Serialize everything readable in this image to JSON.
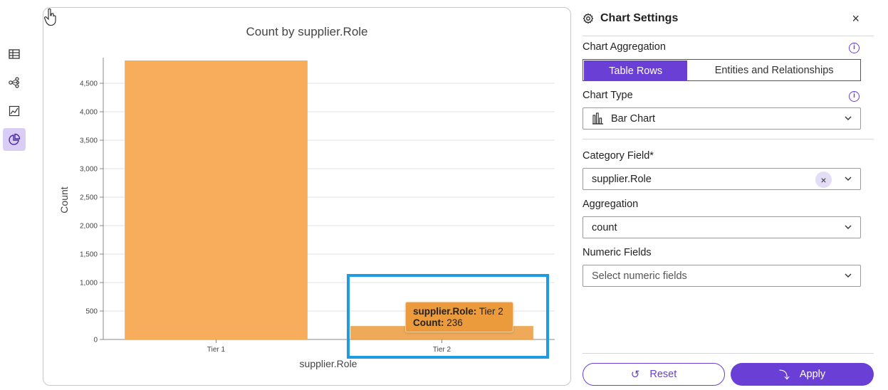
{
  "rail": {
    "items": [
      {
        "icon": "table-icon",
        "active": false
      },
      {
        "icon": "graph-network-icon",
        "active": false
      },
      {
        "icon": "chart-line-icon",
        "active": false
      },
      {
        "icon": "pie-chart-icon",
        "active": true
      }
    ]
  },
  "chart_data": {
    "type": "bar",
    "title": "Count by supplier.Role",
    "xlabel": "supplier.Role",
    "ylabel": "Count",
    "categories": [
      "Tier 1",
      "Tier 2"
    ],
    "values": [
      4900,
      236
    ],
    "yticks": [
      0,
      500,
      1000,
      1500,
      2000,
      2500,
      3000,
      3500,
      4000,
      4500
    ],
    "ytick_labels": [
      "0",
      "500",
      "1,000",
      "1,500",
      "2,000",
      "2,500",
      "3,000",
      "3,500",
      "4,000",
      "4,500"
    ],
    "ylim": [
      0,
      4950
    ],
    "bar_color": "#f7ad5b",
    "hover_bar_color": "#eb9a3c",
    "grid": true
  },
  "tooltip": {
    "field_label": "supplier.Role:",
    "field_value": "Tier 2",
    "count_label": "Count:",
    "count_value": "236"
  },
  "panel": {
    "title": "Chart Settings",
    "close": "×",
    "aggregation_label": "Chart Aggregation",
    "aggregation_options": [
      "Table Rows",
      "Entities and Relationships"
    ],
    "aggregation_selected": "Table Rows",
    "chart_type_label": "Chart Type",
    "chart_type_value": "Bar Chart",
    "category_label": "Category Field*",
    "category_value": "supplier.Role",
    "aggregation_fn_label": "Aggregation",
    "aggregation_fn_value": "count",
    "numeric_label": "Numeric Fields",
    "numeric_placeholder": "Select numeric fields",
    "reset_label": "Reset",
    "apply_label": "Apply",
    "accent_color": "#6a3fd6"
  }
}
